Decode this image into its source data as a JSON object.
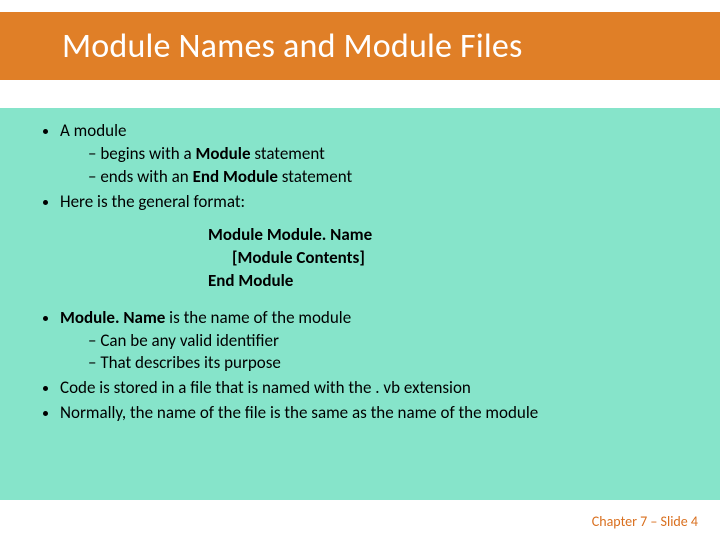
{
  "title": "Module Names and Module Files",
  "bullets": {
    "a_module": "A module",
    "begins_prefix": "begins with a ",
    "begins_bold": "Module",
    "begins_suffix": " statement",
    "ends_prefix": "ends with an ",
    "ends_bold": "End Module",
    "ends_suffix": " statement",
    "format": "Here is the general format:"
  },
  "code": {
    "l1": "Module Module. Name",
    "l2": "[Module Contents]",
    "l3": "End Module"
  },
  "bullets2": {
    "mn_bold": "Module. Name",
    "mn_rest": " is the name of the module",
    "mn_sub1": "Can be any valid identifier",
    "mn_sub2": "That describes its purpose",
    "code_file": "Code is stored in a file that is named with the . vb extension",
    "normally": "Normally, the name of the file is the same as the name of the module"
  },
  "footer": "Chapter 7 – Slide 4"
}
